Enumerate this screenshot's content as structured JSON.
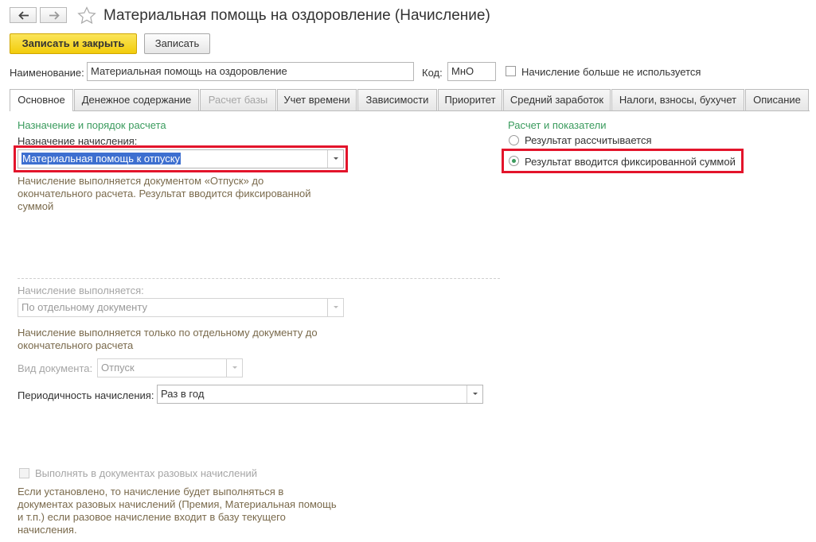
{
  "window": {
    "title": "Материальная помощь на оздоровление (Начисление)"
  },
  "icons": {
    "back": "arrow-left-icon",
    "forward": "arrow-right-icon",
    "favorite": "star-icon"
  },
  "toolbar": {
    "save_close_label": "Записать и закрыть",
    "save_label": "Записать"
  },
  "header": {
    "name_label": "Наименование:",
    "name_value": "Материальная помощь на оздоровление",
    "code_label": "Код:",
    "code_value": "МнО",
    "unused_label": "Начисление больше не используется",
    "unused_checked": false
  },
  "tabs": [
    {
      "label": "Основное",
      "active": true,
      "enabled": true
    },
    {
      "label": "Денежное содержание",
      "active": false,
      "enabled": true
    },
    {
      "label": "Расчет базы",
      "active": false,
      "enabled": false
    },
    {
      "label": "Учет времени",
      "active": false,
      "enabled": true
    },
    {
      "label": "Зависимости",
      "active": false,
      "enabled": true
    },
    {
      "label": "Приоритет",
      "active": false,
      "enabled": true
    },
    {
      "label": "Средний заработок",
      "active": false,
      "enabled": true
    },
    {
      "label": "Налоги, взносы, бухучет",
      "active": false,
      "enabled": true
    },
    {
      "label": "Описание",
      "active": false,
      "enabled": true
    }
  ],
  "main": {
    "left_group_title": "Назначение и порядок расчета",
    "purpose_label": "Назначение начисления:",
    "purpose_value": "Материальная помощь к отпуску",
    "purpose_hint_1": "Начисление выполняется документом «Отпуск» до",
    "purpose_hint_2": "окончательного расчета. Результат вводится фиксированной",
    "purpose_hint_3": "суммой",
    "execution_label": "Начисление выполняется:",
    "execution_value": "По отдельному документу",
    "execution_hint_1": "Начисление выполняется только по отдельному документу до",
    "execution_hint_2": "окончательного расчета",
    "doc_type_label": "Вид документа:",
    "doc_type_value": "Отпуск",
    "periodicity_label": "Периодичность начисления:",
    "periodicity_value": "Раз в год",
    "one_time_label": "Выполнять в документах разовых начислений",
    "one_time_checked": false,
    "one_time_hint_1": "Если установлено, то начисление будет выполняться в",
    "one_time_hint_2": "документах разовых начислений (Премия, Материальная помощь",
    "one_time_hint_3": "и т.п.) если разовое начисление входит в базу текущего",
    "one_time_hint_4": "начисления.",
    "right_group_title": "Расчет и показатели",
    "radio_calculated": "Результат рассчитывается",
    "radio_fixed": "Результат вводится фиксированной суммой",
    "selected_radio": "fixed"
  },
  "colors": {
    "accent_green": "#3a9b5d",
    "highlight_red": "#e3142b",
    "primary_yellow": "#f2cc0b",
    "selection_blue": "#3d6fd0"
  }
}
